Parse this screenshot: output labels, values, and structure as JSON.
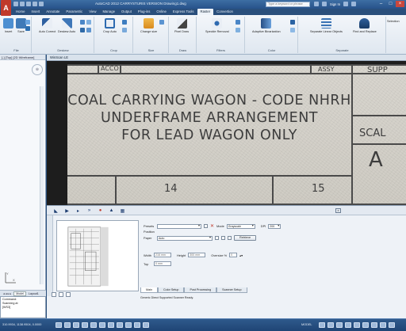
{
  "window": {
    "app_icon": "A",
    "title": "AutoCAD 2012   CARRYSTURIS VERSION   Drawing1.dwg",
    "search_placeholder": "Type a keyword or phrase",
    "sign_in": "Sign In",
    "colors": {
      "titlebar": "#27528a",
      "ribbon": "#e6ecf3",
      "canvas": "#1d1d1d",
      "paper": "#d4d1ca"
    }
  },
  "tabs": [
    "Home",
    "Insert",
    "Annotate",
    "Parametric",
    "View",
    "Manage",
    "Output",
    "Plug-ins",
    "Online",
    "Express Tools",
    "Raster",
    "Convertion"
  ],
  "active_tab": "Raster",
  "ribbon": {
    "panels": [
      {
        "label": "File",
        "buttons": [
          "Insert",
          "Save"
        ]
      },
      {
        "label": "Deskew",
        "buttons": [
          "Auto Correct",
          "Deskew Auto"
        ]
      },
      {
        "label": "Crop",
        "buttons": [
          "Crop Auto"
        ]
      },
      {
        "label": "Size",
        "buttons": [
          "Change size"
        ]
      },
      {
        "label": "Draw",
        "buttons": [
          "Pixel Draw"
        ]
      },
      {
        "label": "Filters",
        "buttons": [
          "Speckle Removal"
        ]
      },
      {
        "label": "Color",
        "buttons": [
          "Adaptive Binarization"
        ]
      },
      {
        "label": "Separate",
        "buttons": [
          "Separate Linear Objects",
          "Find and Replace"
        ]
      },
      {
        "label": "",
        "buttons": [
          "Selection"
        ]
      }
    ]
  },
  "left_panel": {
    "header": "[-] [Top] [2D Wireframe]",
    "tabs": [
      "Model",
      "Layout1"
    ]
  },
  "drawing_tab": "WinScan LE",
  "scan": {
    "top_cells": [
      "ASSY",
      "SUPP"
    ],
    "top_partial": "ACCO",
    "line1": "COAL CARRYING WAGON - CODE NHRH",
    "line2": "UNDERFRAME ARRANGEMENT",
    "line3": "FOR LEAD WAGON ONLY",
    "side_label": "SCAL",
    "side_letter": "A",
    "col_a": "14",
    "col_b": "15"
  },
  "scanner_dialog": {
    "toolbar_icons": [
      "preview-icon",
      "scan-icon",
      "play-icon",
      "fast-forward-icon",
      "record-icon",
      "acquire-icon",
      "settings-icon"
    ],
    "preset_label": "Presets",
    "preset_value": "",
    "mode_label": "Mode",
    "mode_value": "Grayscale",
    "dpi_label": "DPI",
    "dpi_value": "200",
    "position_label": "Position",
    "paper_label": "Paper",
    "paper_value": "Auto",
    "retrieve_label": "Retrieve",
    "width_label": "Width",
    "width_value": "216 mm",
    "height_label": "Height",
    "height_value": "300 mm",
    "oversize_label": "Oversize %",
    "oversize_value": "0",
    "top_label": "Top",
    "top_value": "0 mm",
    "tabs": [
      "Main",
      "Color Setup",
      "Post Processing",
      "Scanner Setup"
    ],
    "active_tab": "Main",
    "status": "Generic Direct Supported Scanner Ready."
  },
  "command_line": {
    "label": "Command:",
    "lines": [
      "Scanning at",
      "[WS3]"
    ]
  },
  "status_bar": {
    "coords": "310.9934, 1138.9504, 0.0000",
    "right_text": "MODEL"
  }
}
